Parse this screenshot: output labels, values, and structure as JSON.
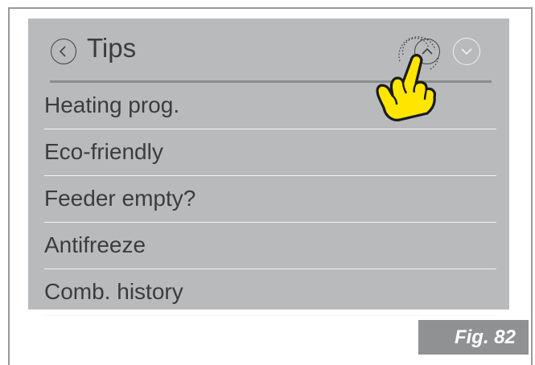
{
  "header": {
    "title": "Tips",
    "back_icon": "chevron-left-icon",
    "up_icon": "chevron-up-icon",
    "down_icon": "chevron-down-icon"
  },
  "list": {
    "items": [
      {
        "label": "Heating prog."
      },
      {
        "label": "Eco-friendly"
      },
      {
        "label": "Feeder empty?"
      },
      {
        "label": "Antifreeze"
      },
      {
        "label": "Comb. history"
      }
    ]
  },
  "annotation": {
    "figure_label": "Fig. 82",
    "pointer_icon": "pointing-hand-icon"
  },
  "colors": {
    "screen_background": "#b8babc",
    "hand_fill": "#ffe600",
    "figure_badge": "#8f9193"
  }
}
